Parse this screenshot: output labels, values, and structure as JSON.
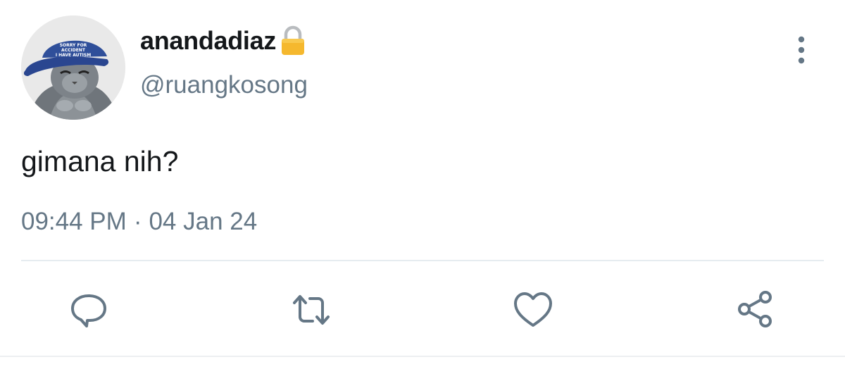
{
  "tweet": {
    "display_name": "anandadiaz",
    "handle": "@ruangkosong",
    "text": "gimana nih?",
    "time": "09:44 PM",
    "separator": "·",
    "date": "04 Jan 24",
    "avatar_cap_text": [
      "SORRY FOR",
      "ACCIDENT",
      "I HAVE AUTISM"
    ]
  },
  "icons": {
    "protected": "lock-icon",
    "menu": "more-vertical-icon",
    "reply": "reply-icon",
    "retweet": "retweet-icon",
    "like": "heart-icon",
    "share": "share-icon"
  },
  "colors": {
    "text": "#14171a",
    "secondary": "#657786",
    "icon": "#657786",
    "divider": "#e6ecf0",
    "lock": "#f5b82e"
  }
}
